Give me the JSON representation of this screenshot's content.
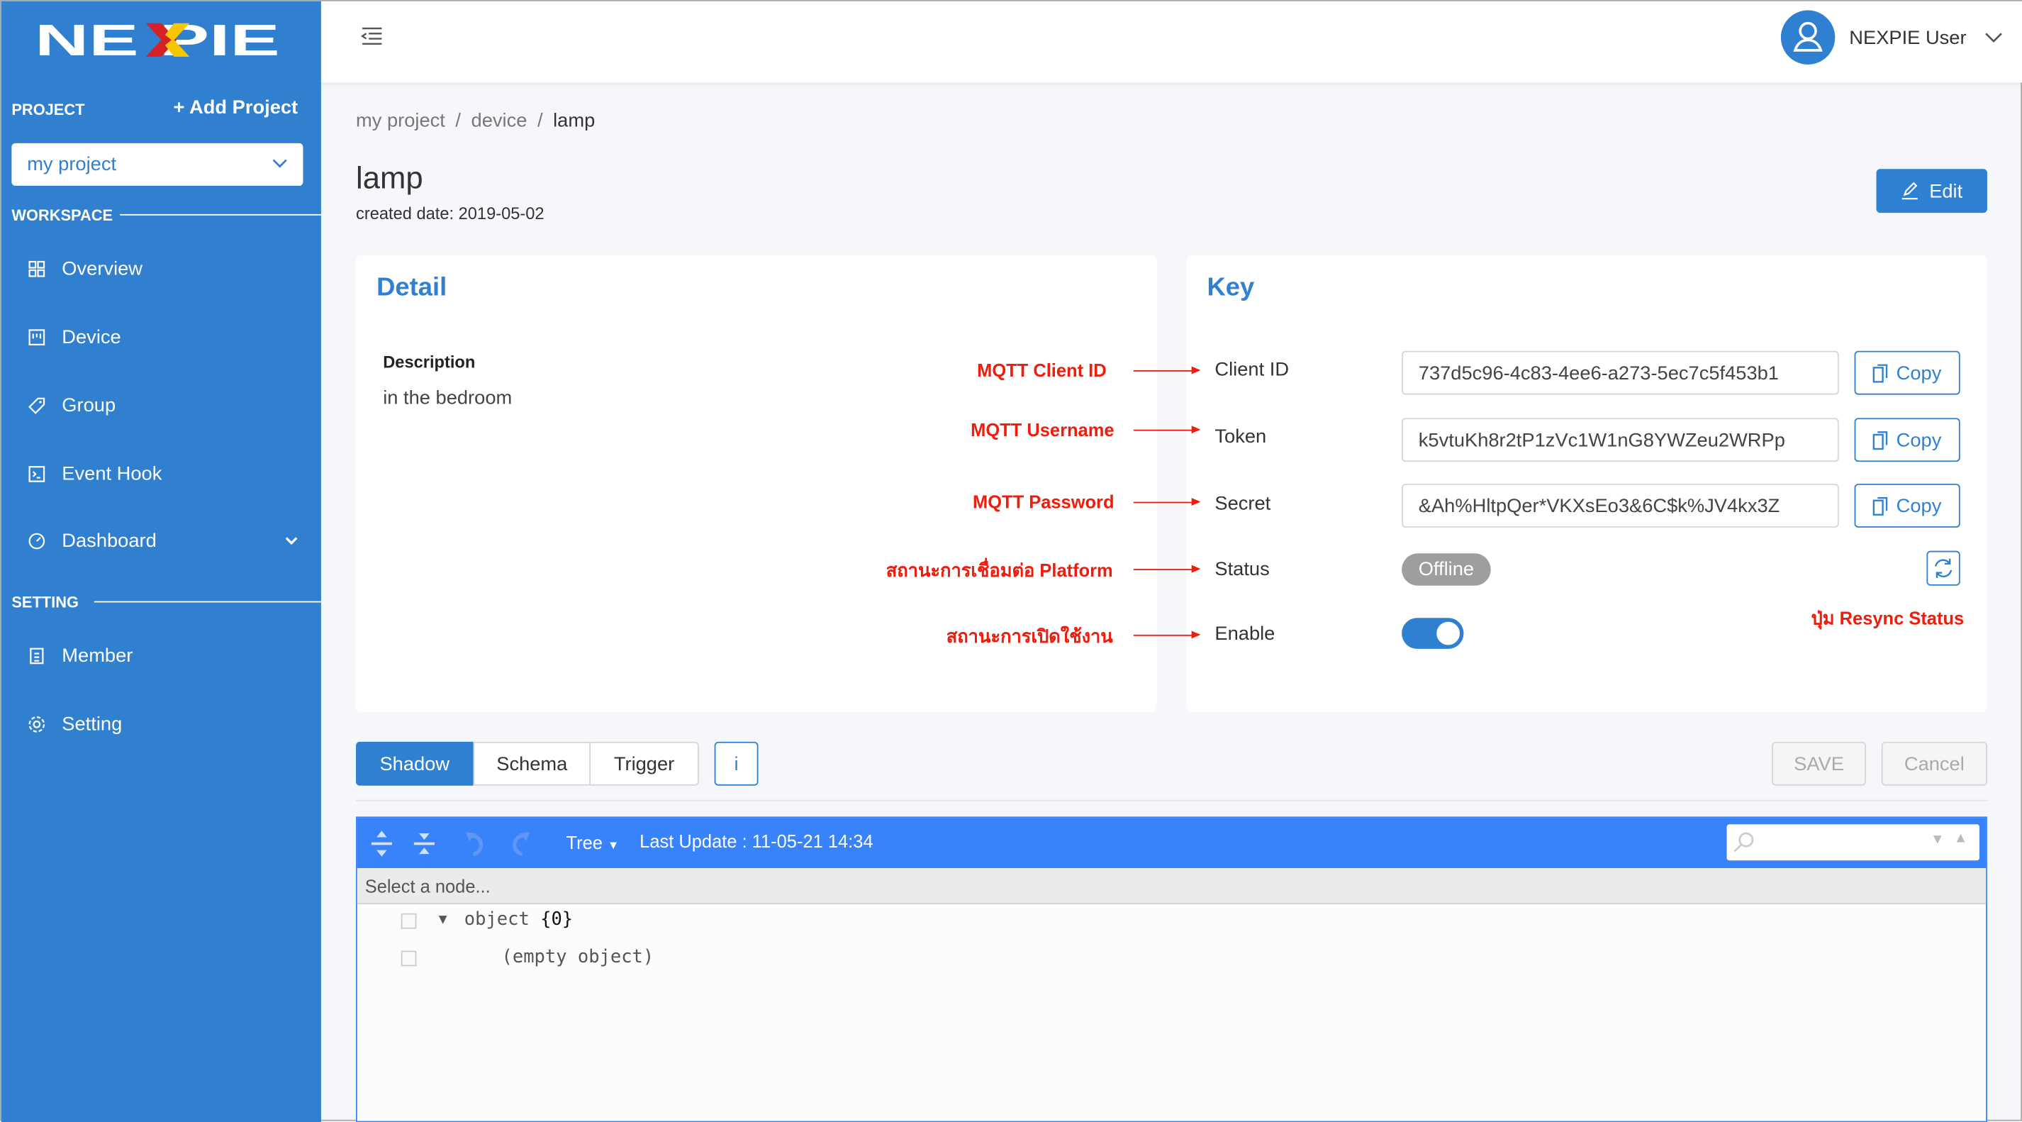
{
  "brand": {
    "logo_text": "NEXPIE",
    "colors": {
      "sidebar": "#317fcf",
      "primary": "#2f80d1",
      "annotation": "#f01c0c",
      "editor_toolbar": "#3883fa"
    }
  },
  "sidebar": {
    "project_label": "PROJECT",
    "add_project": "+ Add Project",
    "project_select": "my project",
    "workspace_label": "WORKSPACE",
    "setting_label": "SETTING",
    "items": [
      {
        "label": "Overview",
        "icon": "grid-icon"
      },
      {
        "label": "Device",
        "icon": "device-icon"
      },
      {
        "label": "Group",
        "icon": "tag-icon"
      },
      {
        "label": "Event Hook",
        "icon": "terminal-icon"
      },
      {
        "label": "Dashboard",
        "icon": "gauge-icon"
      },
      {
        "label": "Member",
        "icon": "member-icon"
      },
      {
        "label": "Setting",
        "icon": "gear-icon"
      }
    ]
  },
  "header": {
    "user_name": "NEXPIE User"
  },
  "breadcrumb": [
    "my project",
    "device",
    "lamp"
  ],
  "page": {
    "title": "lamp",
    "created": "created date: 2019-05-02",
    "edit_label": "Edit"
  },
  "detail": {
    "heading": "Detail",
    "description_label": "Description",
    "description_value": "in the bedroom"
  },
  "key": {
    "heading": "Key",
    "rows": [
      {
        "annotation": "MQTT Client ID",
        "label": "Client ID",
        "value": "737d5c96-4c83-4ee6-a273-5ec7c5f453b1",
        "copy": "Copy"
      },
      {
        "annotation": "MQTT Username",
        "label": "Token",
        "value": "k5vtuKh8r2tP1zVc1W1nG8YWZeu2WRPp",
        "copy": "Copy"
      },
      {
        "annotation": "MQTT Password",
        "label": "Secret",
        "value": "&Ah%HltpQer*VKXsEo3&6C$k%JV4kx3Z",
        "copy": "Copy"
      },
      {
        "annotation": "สถานะการเชื่อมต่อ Platform",
        "label": "Status",
        "value": "Offline"
      },
      {
        "annotation": "สถานะการเปิดใช้งาน",
        "label": "Enable",
        "enabled": true
      }
    ],
    "resync_annotation": "ปุ่ม Resync Status"
  },
  "tabs": {
    "items": [
      "Shadow",
      "Schema",
      "Trigger"
    ],
    "active": "Shadow",
    "info": "i",
    "save": "SAVE",
    "cancel": "Cancel"
  },
  "editor": {
    "mode": "Tree",
    "last_update": "Last Update : 11-05-21 14:34",
    "status": "Select a node...",
    "root": "object",
    "root_count": "{0}",
    "empty": "(empty object)"
  }
}
